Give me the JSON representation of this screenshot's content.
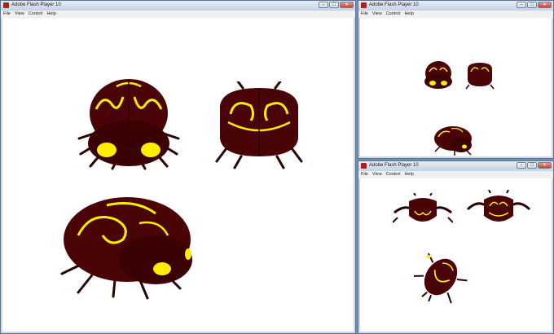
{
  "windows": {
    "main": {
      "title": "Adobe Flash Player 10",
      "menu": [
        "File",
        "View",
        "Control",
        "Help"
      ]
    },
    "top_right": {
      "title": "Adobe Flash Player 10",
      "menu": [
        "File",
        "View",
        "Control",
        "Help"
      ]
    },
    "bottom_right": {
      "title": "Adobe Flash Player 10",
      "menu": [
        "File",
        "View",
        "Control",
        "Help"
      ]
    }
  },
  "controls": {
    "minimize": "–",
    "maximize": "□",
    "close": "✕"
  },
  "colors": {
    "beetle_body": "#4a0405",
    "beetle_dark": "#2a0102",
    "beetle_marking": "#ffee00",
    "desktop": "#6f8fb5"
  }
}
